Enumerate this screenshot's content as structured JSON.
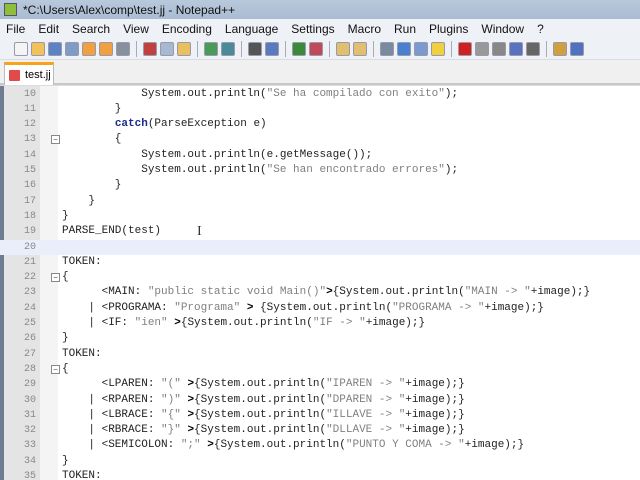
{
  "window": {
    "title": "*C:\\Users\\Alex\\comp\\test.jj - Notepad++"
  },
  "menu": [
    "File",
    "Edit",
    "Search",
    "View",
    "Encoding",
    "Language",
    "Settings",
    "Macro",
    "Run",
    "Plugins",
    "Window",
    "?"
  ],
  "toolbar_icons": [
    "new",
    "open",
    "save",
    "save-all",
    "close",
    "close-all",
    "print",
    "cut",
    "copy",
    "paste",
    "undo",
    "redo",
    "find",
    "replace",
    "zoom-in",
    "zoom-out",
    "sync-v",
    "sync-h",
    "wrap",
    "all-chars",
    "indent-guide",
    "user-lang",
    "record",
    "stop",
    "play",
    "play-multiple",
    "save-macro",
    "launch",
    "spell-check"
  ],
  "tab": {
    "label": "test.jj"
  },
  "code": {
    "lines": [
      {
        "n": "10",
        "s": [
          [
            "            System.out.println(",
            ""
          ],
          [
            "\"Se ha compilado con exito\"",
            "str"
          ],
          [
            ");",
            ""
          ]
        ]
      },
      {
        "n": "11",
        "s": [
          [
            "        }",
            ""
          ]
        ]
      },
      {
        "n": "12",
        "s": [
          [
            "        ",
            ""
          ],
          [
            "catch",
            "kw"
          ],
          [
            "(ParseException e)",
            ""
          ]
        ]
      },
      {
        "n": "13",
        "fold": true,
        "s": [
          [
            "        {",
            ""
          ]
        ]
      },
      {
        "n": "14",
        "s": [
          [
            "            System.out.println(e.getMessage());",
            ""
          ]
        ]
      },
      {
        "n": "15",
        "s": [
          [
            "            System.out.println(",
            ""
          ],
          [
            "\"Se han encontrado errores\"",
            "str"
          ],
          [
            ");",
            ""
          ]
        ]
      },
      {
        "n": "16",
        "s": [
          [
            "        }",
            ""
          ]
        ]
      },
      {
        "n": "17",
        "s": [
          [
            "    }",
            ""
          ]
        ]
      },
      {
        "n": "18",
        "s": [
          [
            "}",
            ""
          ]
        ]
      },
      {
        "n": "19",
        "s": [
          [
            "PARSE_END(test)",
            ""
          ]
        ]
      },
      {
        "n": "20",
        "cur": true,
        "s": [
          [
            "",
            ""
          ]
        ]
      },
      {
        "n": "21",
        "s": [
          [
            "TOKEN:",
            ""
          ]
        ]
      },
      {
        "n": "22",
        "fold": true,
        "s": [
          [
            "{",
            ""
          ]
        ]
      },
      {
        "n": "23",
        "s": [
          [
            "      <MAIN: ",
            ""
          ],
          [
            "\"public static void Main()\"",
            "str"
          ],
          [
            ">",
            "op"
          ],
          [
            "{System.out.println(",
            ""
          ],
          [
            "\"MAIN -> \"",
            "str"
          ],
          [
            "+image);}",
            ""
          ]
        ]
      },
      {
        "n": "24",
        "s": [
          [
            "    | <PROGRAMA: ",
            ""
          ],
          [
            "\"Programa\"",
            "str"
          ],
          [
            " > ",
            "op"
          ],
          [
            "{System.out.println(",
            ""
          ],
          [
            "\"PROGRAMA -> \"",
            "str"
          ],
          [
            "+image);}",
            ""
          ]
        ]
      },
      {
        "n": "25",
        "s": [
          [
            "    | <IF: ",
            ""
          ],
          [
            "\"ien\"",
            "str"
          ],
          [
            " >",
            "op"
          ],
          [
            "{System.out.println(",
            ""
          ],
          [
            "\"IF -> \"",
            "str"
          ],
          [
            "+image);}",
            ""
          ]
        ]
      },
      {
        "n": "26",
        "s": [
          [
            "}",
            ""
          ]
        ]
      },
      {
        "n": "27",
        "s": [
          [
            "TOKEN:",
            ""
          ]
        ]
      },
      {
        "n": "28",
        "fold": true,
        "s": [
          [
            "{",
            ""
          ]
        ]
      },
      {
        "n": "29",
        "s": [
          [
            "      <LPAREN: ",
            ""
          ],
          [
            "\"(\"",
            "str"
          ],
          [
            " >",
            "op"
          ],
          [
            "{System.out.println(",
            ""
          ],
          [
            "\"IPAREN -> \"",
            "str"
          ],
          [
            "+image);}",
            ""
          ]
        ]
      },
      {
        "n": "30",
        "s": [
          [
            "    | <RPAREN: ",
            ""
          ],
          [
            "\")\"",
            "str"
          ],
          [
            " >",
            "op"
          ],
          [
            "{System.out.println(",
            ""
          ],
          [
            "\"DPAREN -> \"",
            "str"
          ],
          [
            "+image);}",
            ""
          ]
        ]
      },
      {
        "n": "31",
        "s": [
          [
            "    | <LBRACE: ",
            ""
          ],
          [
            "\"{\"",
            "str"
          ],
          [
            " >",
            "op"
          ],
          [
            "{System.out.println(",
            ""
          ],
          [
            "\"ILLAVE -> \"",
            "str"
          ],
          [
            "+image);}",
            ""
          ]
        ]
      },
      {
        "n": "32",
        "s": [
          [
            "    | <RBRACE: ",
            ""
          ],
          [
            "\"}\"",
            "str"
          ],
          [
            " >",
            "op"
          ],
          [
            "{System.out.println(",
            ""
          ],
          [
            "\"DLLAVE -> \"",
            "str"
          ],
          [
            "+image);}",
            ""
          ]
        ]
      },
      {
        "n": "33",
        "s": [
          [
            "    | <SEMICOLON: ",
            ""
          ],
          [
            "\";\"",
            "str"
          ],
          [
            " >",
            "op"
          ],
          [
            "{System.out.println(",
            ""
          ],
          [
            "\"PUNTO Y COMA -> \"",
            "str"
          ],
          [
            "+image);}",
            ""
          ]
        ]
      },
      {
        "n": "34",
        "s": [
          [
            "}",
            ""
          ]
        ]
      },
      {
        "n": "35",
        "s": [
          [
            "TOKEN:",
            ""
          ]
        ]
      }
    ]
  }
}
